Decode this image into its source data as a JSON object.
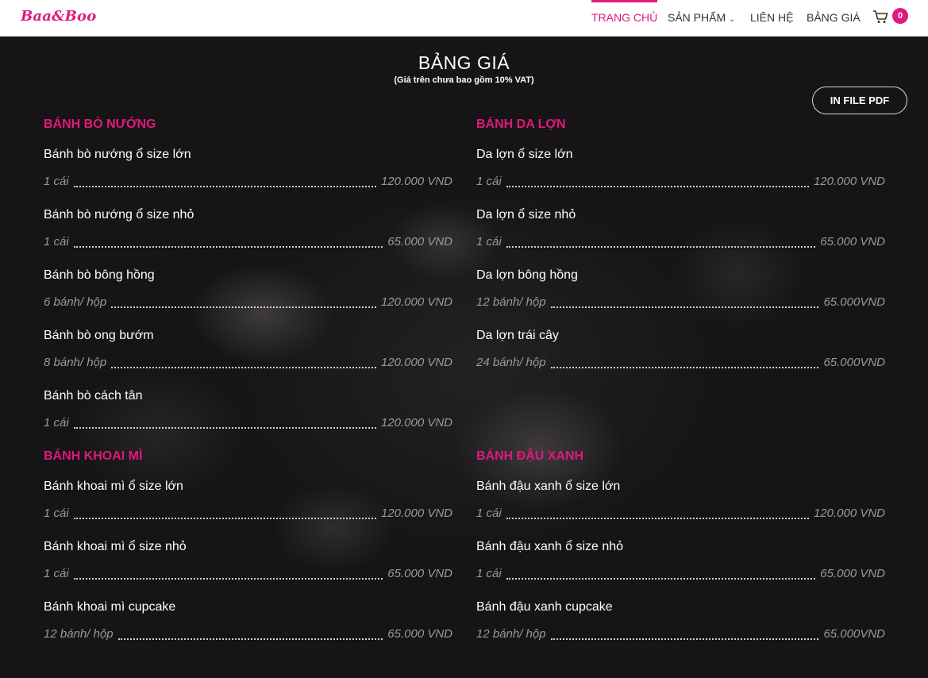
{
  "header": {
    "logo": "Baa&Boo",
    "nav": [
      {
        "label": "TRANG CHỦ",
        "active": true
      },
      {
        "label": "SẢN PHẨM",
        "has_dropdown": true
      },
      {
        "label": "LIÊN HỆ"
      },
      {
        "label": "BẢNG GIÁ"
      }
    ],
    "cart_count": "0"
  },
  "page": {
    "title": "BẢNG GIÁ",
    "subtitle": "(Giá trên chưa bao gồm 10% VAT)",
    "pdf_button": "IN FILE PDF"
  },
  "sections": [
    {
      "title": "BÁNH BÒ NƯỚNG",
      "items": [
        {
          "name": "Bánh bò nướng ổ size lớn",
          "unit": "1 cái",
          "price": "120.000 VND"
        },
        {
          "name": "Bánh bò nướng ổ size nhỏ",
          "unit": "1 cái",
          "price": "65.000 VND"
        },
        {
          "name": "Bánh bò bông hồng",
          "unit": "6 bánh/ hộp",
          "price": "120.000 VND"
        },
        {
          "name": "Bánh bò ong bướm",
          "unit": "8 bánh/ hộp",
          "price": "120.000 VND"
        },
        {
          "name": "Bánh bò cách tân",
          "unit": "1 cái",
          "price": "120.000 VND"
        }
      ]
    },
    {
      "title": "BÁNH DA LỢN",
      "items": [
        {
          "name": "Da lợn ổ size lớn",
          "unit": "1 cái",
          "price": "120.000 VND"
        },
        {
          "name": "Da lợn ổ size nhỏ",
          "unit": "1 cái",
          "price": "65.000 VND"
        },
        {
          "name": "Da lợn bông hồng",
          "unit": "12 bánh/ hộp",
          "price": "65.000VND"
        },
        {
          "name": "Da lợn trái cây",
          "unit": "24 bánh/ hộp",
          "price": "65.000VND"
        }
      ]
    },
    {
      "title": "BÁNH KHOAI MÌ",
      "items": [
        {
          "name": "Bánh khoai mì ổ size lớn",
          "unit": "1 cái",
          "price": "120.000 VND"
        },
        {
          "name": "Bánh khoai mì ổ size nhỏ",
          "unit": "1 cái",
          "price": "65.000 VND"
        },
        {
          "name": "Bánh khoai mì cupcake",
          "unit": "12 bánh/ hộp",
          "price": "65.000 VND"
        }
      ]
    },
    {
      "title": "BÁNH ĐẬU XANH",
      "items": [
        {
          "name": "Bánh đậu xanh ổ size lớn",
          "unit": "1 cái",
          "price": "120.000 VND"
        },
        {
          "name": "Bánh đậu xanh ổ size nhỏ",
          "unit": "1 cái",
          "price": "65.000 VND"
        },
        {
          "name": "Bánh đậu xanh cupcake",
          "unit": "12 bánh/ hộp",
          "price": "65.000VND"
        }
      ]
    }
  ],
  "colors": {
    "accent": "#e0197d",
    "background": "#161415",
    "muted": "#9a9a9a"
  }
}
